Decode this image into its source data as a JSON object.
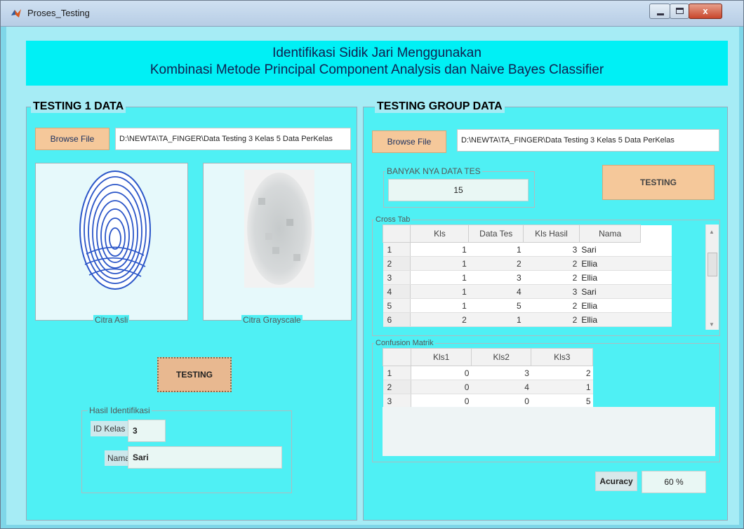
{
  "window": {
    "title": "Proses_Testing",
    "close_glyph": "x"
  },
  "banner": {
    "line1": "Identifikasi Sidik Jari Menggunakan",
    "line2": "Kombinasi Metode Principal Component Analysis dan Naive Bayes Classifier"
  },
  "left": {
    "title": "TESTING 1 DATA",
    "browse_label": "Browse File",
    "path": "D:\\NEWTA\\TA_FINGER\\Data Testing 3 Kelas 5 Data PerKelas",
    "orig_caption": "Citra Asli",
    "gray_caption": "Citra Grayscale",
    "testing_label": "TESTING",
    "result": {
      "title": "Hasil Identifikasi",
      "id_label": "ID Kelas",
      "id_value": "3",
      "name_label": "Nama",
      "name_value": "Sari"
    }
  },
  "right": {
    "title": "TESTING GROUP DATA",
    "browse_label": "Browse File",
    "path": "D:\\NEWTA\\TA_FINGER\\Data Testing 3 Kelas 5 Data PerKelas",
    "count_title": "BANYAK NYA DATA TES",
    "count_value": "15",
    "testing_label": "TESTING",
    "crosstab": {
      "title": "Cross Tab",
      "columns": [
        "Kls",
        "Data Tes",
        "Kls Hasil",
        "Nama"
      ],
      "rows": [
        {
          "n": "1",
          "kls": "1",
          "data": "1",
          "hasil": "3",
          "nama": "Sari"
        },
        {
          "n": "2",
          "kls": "1",
          "data": "2",
          "hasil": "2",
          "nama": "Ellia"
        },
        {
          "n": "3",
          "kls": "1",
          "data": "3",
          "hasil": "2",
          "nama": "Ellia"
        },
        {
          "n": "4",
          "kls": "1",
          "data": "4",
          "hasil": "3",
          "nama": "Sari"
        },
        {
          "n": "5",
          "kls": "1",
          "data": "5",
          "hasil": "2",
          "nama": "Ellia"
        },
        {
          "n": "6",
          "kls": "2",
          "data": "1",
          "hasil": "2",
          "nama": "Ellia"
        }
      ]
    },
    "confusion": {
      "title": "Confusion Matrik",
      "columns": [
        "Kls1",
        "Kls2",
        "Kls3"
      ],
      "rows": [
        {
          "n": "1",
          "c1": "0",
          "c2": "3",
          "c3": "2"
        },
        {
          "n": "2",
          "c1": "0",
          "c2": "4",
          "c3": "1"
        },
        {
          "n": "3",
          "c1": "0",
          "c2": "0",
          "c3": "5"
        }
      ]
    },
    "accuracy_label": "Acuracy",
    "accuracy_value": "60 %"
  },
  "colors": {
    "panel": "#4ff0f4",
    "banner": "#00f0f5",
    "button": "#f5c89a",
    "background": "#a6ecf5"
  },
  "icons": {
    "app": "matlab-logo-icon",
    "minimize": "minimize-icon",
    "maximize": "maximize-icon",
    "close": "close-icon"
  }
}
